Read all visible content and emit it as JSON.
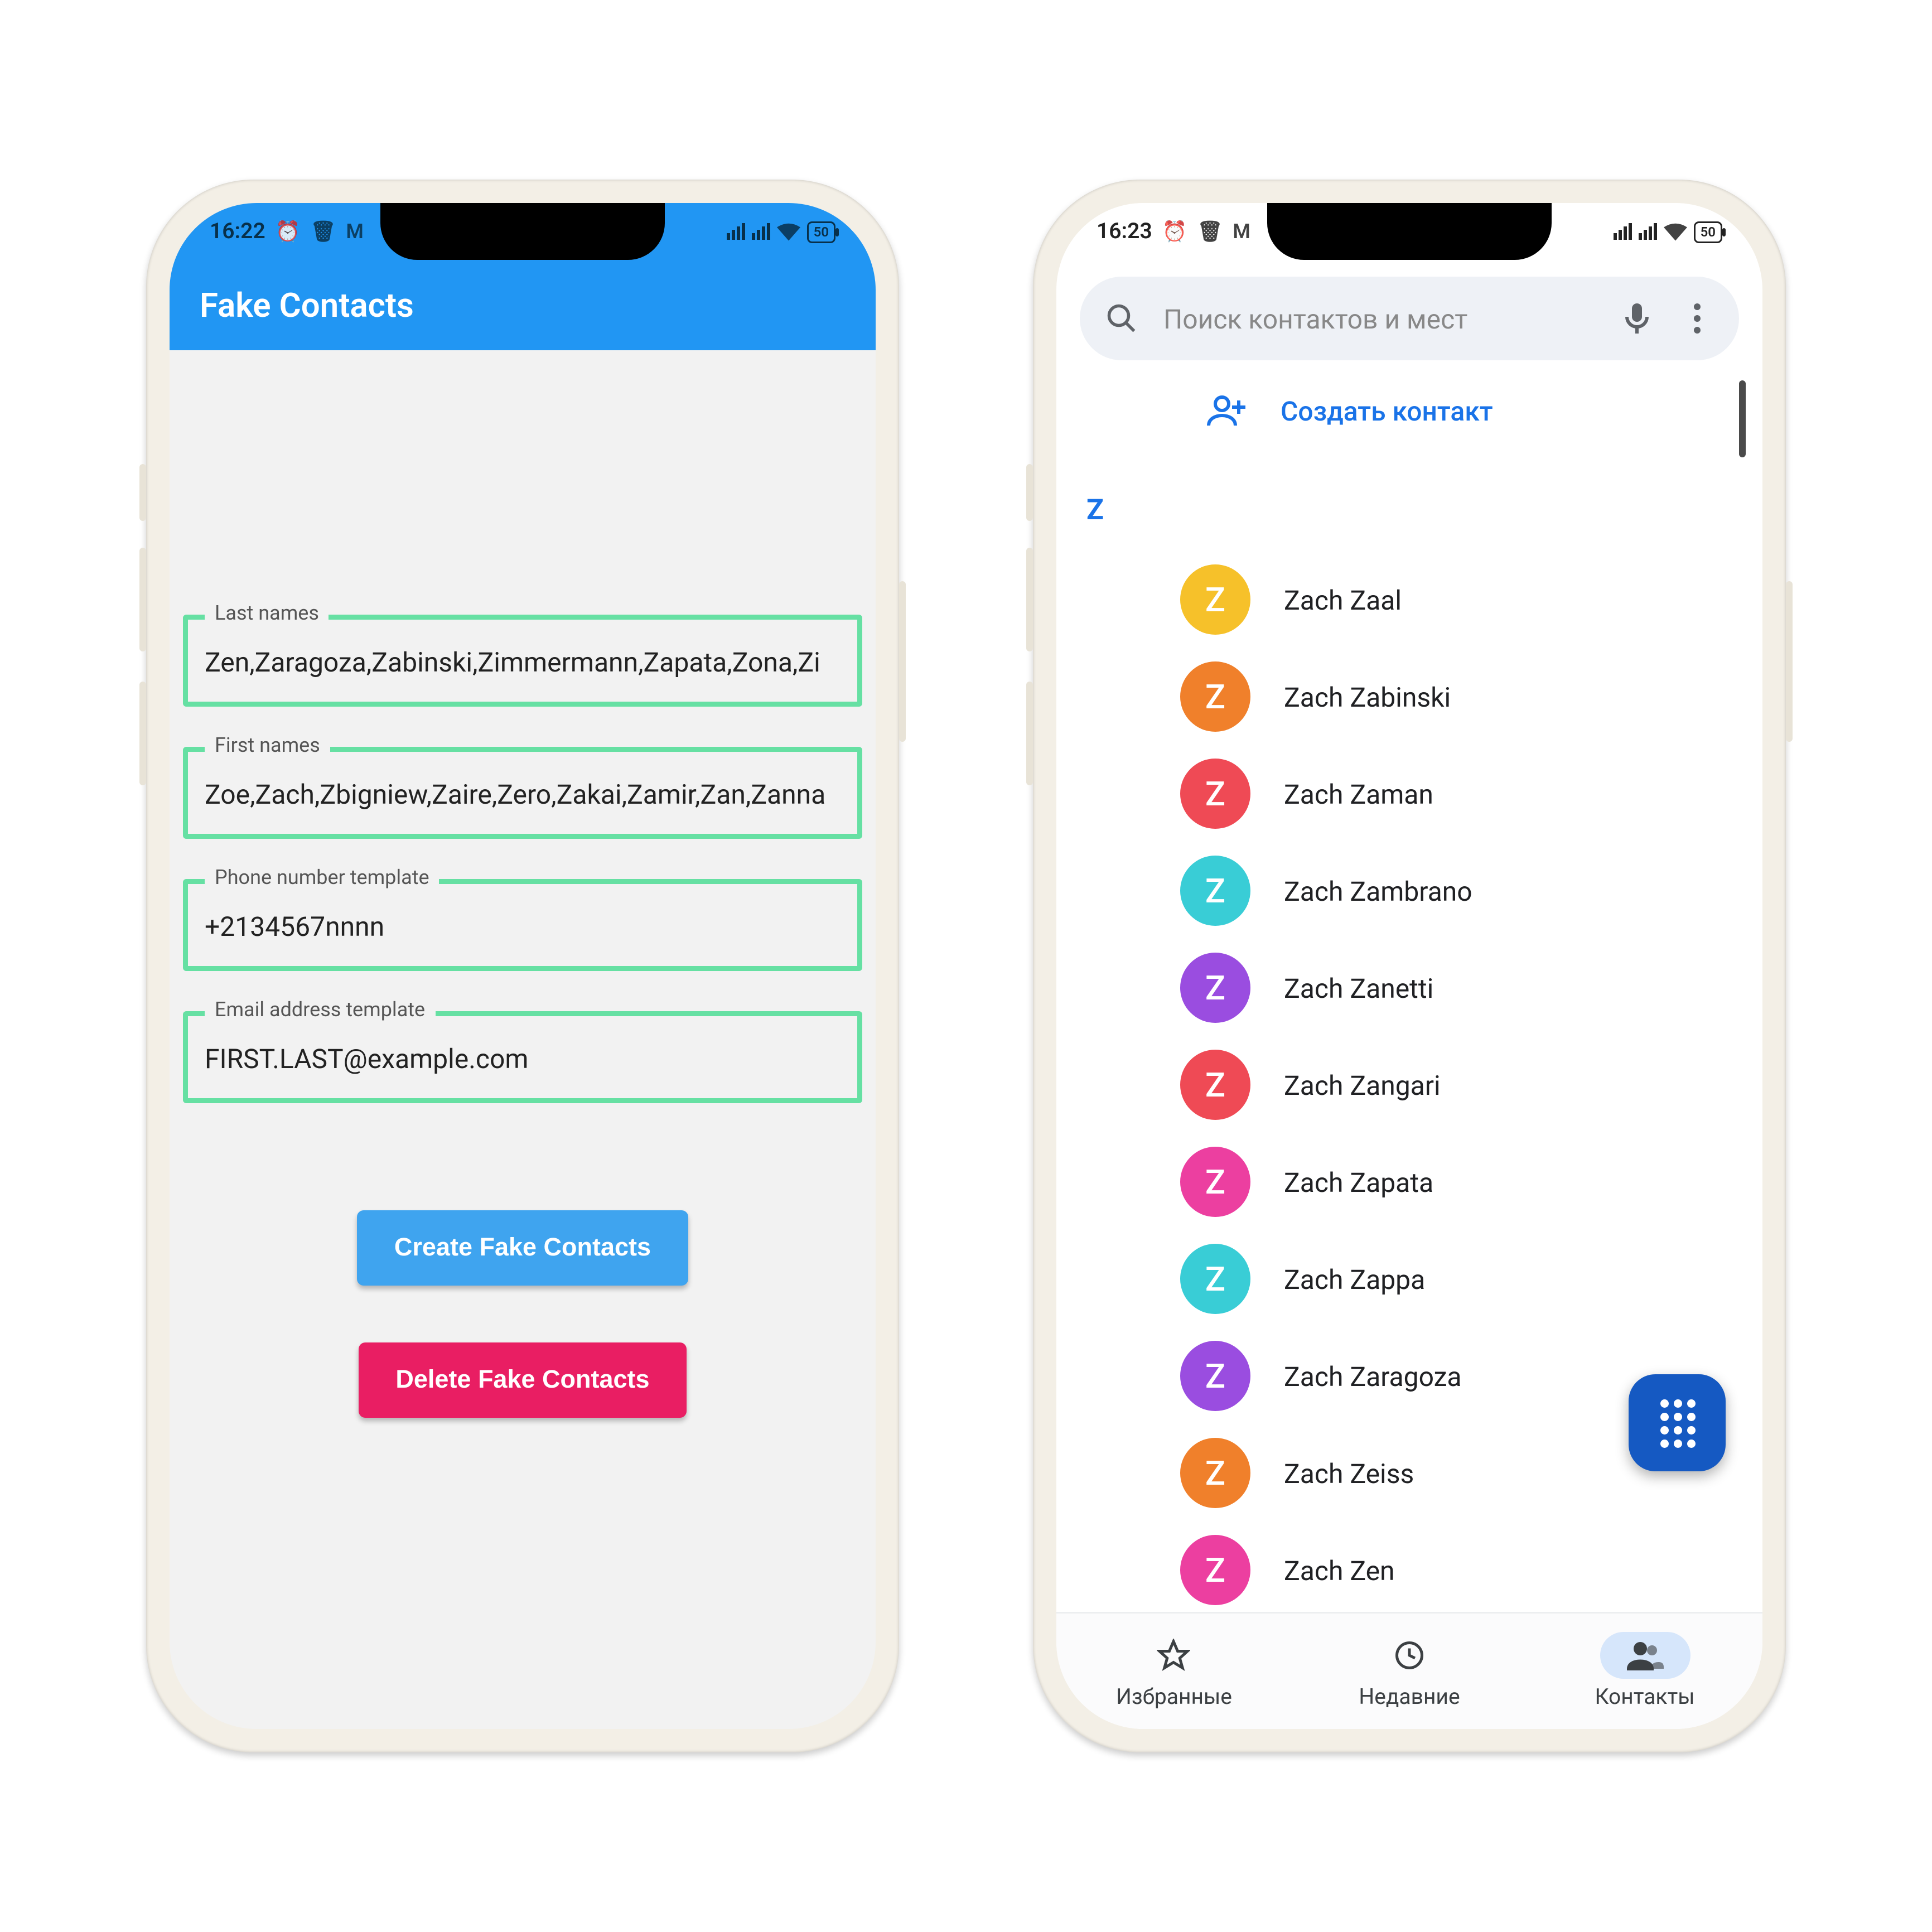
{
  "left": {
    "status": {
      "time": "16:22",
      "battery": "50"
    },
    "app_title": "Fake Contacts",
    "fields": {
      "last_names": {
        "label": "Last names",
        "value": "Zen,Zaragoza,Zabinski,Zimmermann,Zapata,Zona,Zi"
      },
      "first_names": {
        "label": "First names",
        "value": "Zoe,Zach,Zbigniew,Zaire,Zero,Zakai,Zamir,Zan,Zanna"
      },
      "phone_template": {
        "label": "Phone number template",
        "value": "+2134567nnnn"
      },
      "email_template": {
        "label": "Email address template",
        "value": "FIRST.LAST@example.com"
      }
    },
    "buttons": {
      "create": "Create Fake Contacts",
      "delete": "Delete Fake Contacts"
    }
  },
  "right": {
    "status": {
      "time": "16:23",
      "battery": "50"
    },
    "search_placeholder": "Поиск контактов и мест",
    "create_label": "Создать контакт",
    "index_letter": "Z",
    "contacts": [
      {
        "name": "Zach Zaal",
        "letter": "Z",
        "color": "#f6c12a"
      },
      {
        "name": "Zach Zabinski",
        "letter": "Z",
        "color": "#f0802b"
      },
      {
        "name": "Zach Zaman",
        "letter": "Z",
        "color": "#ef4a55"
      },
      {
        "name": "Zach Zambrano",
        "letter": "Z",
        "color": "#39cdd6"
      },
      {
        "name": "Zach Zanetti",
        "letter": "Z",
        "color": "#9a4de0"
      },
      {
        "name": "Zach Zangari",
        "letter": "Z",
        "color": "#ef4a55"
      },
      {
        "name": "Zach Zapata",
        "letter": "Z",
        "color": "#ec3fa0"
      },
      {
        "name": "Zach Zappa",
        "letter": "Z",
        "color": "#39cdd6"
      },
      {
        "name": "Zach Zaragoza",
        "letter": "Z",
        "color": "#9a4de0"
      },
      {
        "name": "Zach Zeiss",
        "letter": "Z",
        "color": "#f0802b"
      },
      {
        "name": "Zach Zen",
        "letter": "Z",
        "color": "#ec3fa0"
      }
    ],
    "nav": {
      "fav": "Избранные",
      "recent": "Недавние",
      "contacts": "Контакты"
    }
  }
}
